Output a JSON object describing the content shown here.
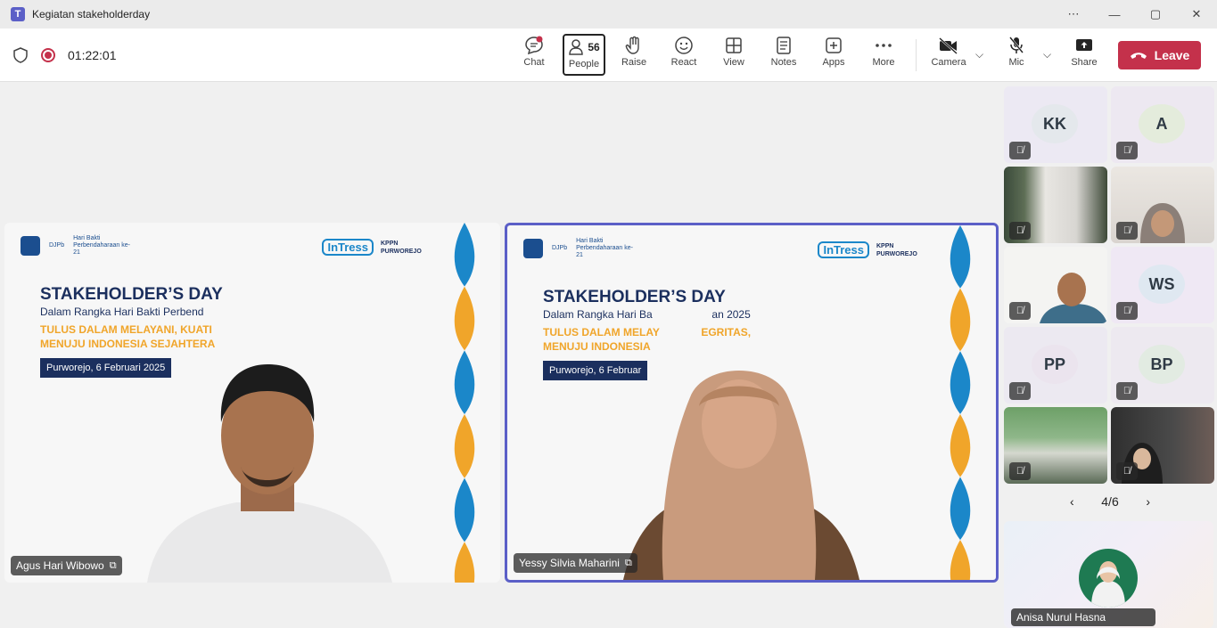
{
  "window": {
    "title": "Kegiatan stakeholderday",
    "controls": [
      "⋯",
      "—",
      "▢",
      "✕"
    ]
  },
  "toolbar": {
    "timer": "01:22:01",
    "buttons": [
      {
        "label": "Chat"
      },
      {
        "label": "People",
        "count": "56"
      },
      {
        "label": "Raise"
      },
      {
        "label": "React"
      },
      {
        "label": "View"
      },
      {
        "label": "Notes"
      },
      {
        "label": "Apps"
      },
      {
        "label": "More"
      },
      {
        "label": "Camera"
      },
      {
        "label": "Mic"
      },
      {
        "label": "Share"
      }
    ],
    "leave_label": "Leave"
  },
  "banner": {
    "kementerian": "DJPb",
    "hari_bakti": "Hari Bakti Perbendaharaan ke-21",
    "intress": "InTress",
    "kppn": "KPPN PURWOREJO",
    "title": "STAKEHOLDER’S DAY",
    "subtitle_1": "Dalam Rangka Hari Bakti Perbend",
    "subtitle_2": "Dalam Rangka Hari Ba                    an 2025",
    "tagline_1": "TULUS DALAM MELAYANI, KUATI\nMENUJU INDONESIA SEJAHTERA",
    "tagline_2": "TULUS DALAM MELAY              EGRITAS,\nMENUJU INDONESIA",
    "date_1": "Purworejo, 6 Februari 2025",
    "date_2": "Purworejo, 6 Februar"
  },
  "stage": {
    "videos": [
      {
        "name": "Agus Hari Wibowo"
      },
      {
        "name": "Yessy Silvia Maharini"
      }
    ]
  },
  "gallery": {
    "tiles": [
      {
        "initials": "KK"
      },
      {
        "initials": "A"
      },
      {
        "initials": ""
      },
      {
        "initials": ""
      },
      {
        "initials": ""
      },
      {
        "initials": "WS"
      },
      {
        "initials": "PP"
      },
      {
        "initials": "BP"
      },
      {
        "initials": ""
      },
      {
        "initials": ""
      }
    ],
    "page": "4/6",
    "featured_name": "Anisa Nurul Hasna"
  },
  "colors": {
    "accent": "#5b5fc7",
    "leave": "#c4314b",
    "banner_navy": "#1b2f5e",
    "banner_gold": "#f0a52a",
    "banner_blue": "#1b87c9"
  }
}
